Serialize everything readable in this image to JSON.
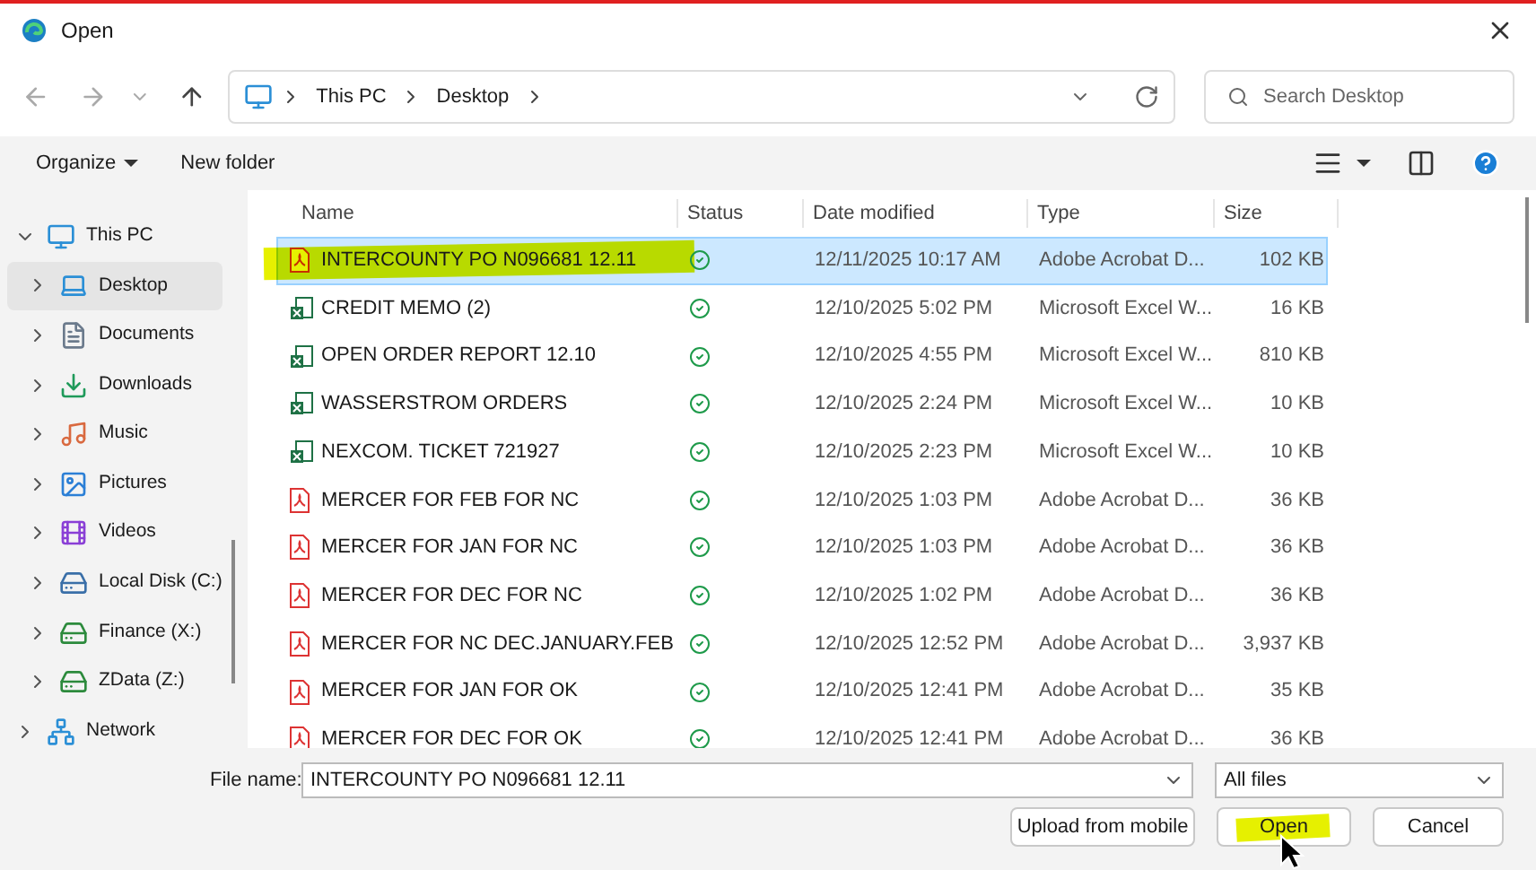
{
  "window": {
    "title": "Open"
  },
  "breadcrumb": [
    "This PC",
    "Desktop"
  ],
  "search": {
    "placeholder": "Search Desktop"
  },
  "toolbar": {
    "organize": "Organize",
    "new_folder": "New folder"
  },
  "sidebar": {
    "items": [
      {
        "label": "This PC",
        "kind": "pc",
        "expanded": true,
        "selected": false,
        "children": [
          {
            "label": "Desktop",
            "kind": "desktop",
            "expanded": false,
            "selected": true
          },
          {
            "label": "Documents",
            "kind": "documents",
            "expanded": false,
            "selected": false
          },
          {
            "label": "Downloads",
            "kind": "downloads",
            "expanded": false,
            "selected": false
          },
          {
            "label": "Music",
            "kind": "music",
            "expanded": false,
            "selected": false
          },
          {
            "label": "Pictures",
            "kind": "pictures",
            "expanded": false,
            "selected": false
          },
          {
            "label": "Videos",
            "kind": "videos",
            "expanded": false,
            "selected": false
          },
          {
            "label": "Local Disk (C:)",
            "kind": "disk",
            "expanded": false,
            "selected": false
          },
          {
            "label": "Finance (X:)",
            "kind": "drive",
            "expanded": false,
            "selected": false
          },
          {
            "label": "ZData (Z:)",
            "kind": "drive",
            "expanded": false,
            "selected": false
          }
        ]
      },
      {
        "label": "Network",
        "kind": "network",
        "expanded": false,
        "selected": false
      }
    ]
  },
  "table": {
    "columns": [
      "Name",
      "Status",
      "Date modified",
      "Type",
      "Size"
    ],
    "rows": [
      {
        "kind": "pdf",
        "name": "INTERCOUNTY PO N096681  12.11",
        "date": "12/11/2025 10:17 AM",
        "type": "Adobe Acrobat D...",
        "size": "102 KB",
        "selected": true,
        "highlighted": true
      },
      {
        "kind": "excel",
        "name": "CREDIT MEMO (2)",
        "date": "12/10/2025 5:02 PM",
        "type": "Microsoft Excel W...",
        "size": "16 KB",
        "selected": false,
        "highlighted": false
      },
      {
        "kind": "excel",
        "name": "OPEN ORDER REPORT 12.10",
        "date": "12/10/2025 4:55 PM",
        "type": "Microsoft Excel W...",
        "size": "810 KB",
        "selected": false,
        "highlighted": false
      },
      {
        "kind": "excel",
        "name": "WASSERSTROM ORDERS",
        "date": "12/10/2025 2:24 PM",
        "type": "Microsoft Excel W...",
        "size": "10 KB",
        "selected": false,
        "highlighted": false
      },
      {
        "kind": "excel",
        "name": "NEXCOM. TICKET 721927",
        "date": "12/10/2025 2:23 PM",
        "type": "Microsoft Excel W...",
        "size": "10 KB",
        "selected": false,
        "highlighted": false
      },
      {
        "kind": "pdf",
        "name": "MERCER FOR FEB FOR NC",
        "date": "12/10/2025 1:03 PM",
        "type": "Adobe Acrobat D...",
        "size": "36 KB",
        "selected": false,
        "highlighted": false
      },
      {
        "kind": "pdf",
        "name": "MERCER FOR JAN  FOR NC",
        "date": "12/10/2025 1:03 PM",
        "type": "Adobe Acrobat D...",
        "size": "36 KB",
        "selected": false,
        "highlighted": false
      },
      {
        "kind": "pdf",
        "name": "MERCER FOR DEC FOR NC",
        "date": "12/10/2025 1:02 PM",
        "type": "Adobe Acrobat D...",
        "size": "36 KB",
        "selected": false,
        "highlighted": false
      },
      {
        "kind": "pdf",
        "name": "MERCER FOR NC  DEC.JANUARY.FEB",
        "date": "12/10/2025 12:52 PM",
        "type": "Adobe Acrobat D...",
        "size": "3,937 KB",
        "selected": false,
        "highlighted": false
      },
      {
        "kind": "pdf",
        "name": "MERCER FOR JAN FOR OK",
        "date": "12/10/2025 12:41 PM",
        "type": "Adobe Acrobat D...",
        "size": "35 KB",
        "selected": false,
        "highlighted": false
      },
      {
        "kind": "pdf",
        "name": "MERCER FOR DEC FOR OK",
        "date": "12/10/2025 12:41 PM",
        "type": "Adobe Acrobat D...",
        "size": "36 KB",
        "selected": false,
        "highlighted": false
      }
    ]
  },
  "file_name": {
    "label": "File name:",
    "value": "INTERCOUNTY PO N096681  12.11"
  },
  "filter": {
    "value": "All files"
  },
  "buttons": [
    {
      "kind": "upload",
      "label": "Upload from mobile",
      "highlighted": false
    },
    {
      "kind": "open",
      "label": "Open",
      "highlighted": true
    },
    {
      "kind": "cancel",
      "label": "Cancel",
      "highlighted": false
    }
  ]
}
